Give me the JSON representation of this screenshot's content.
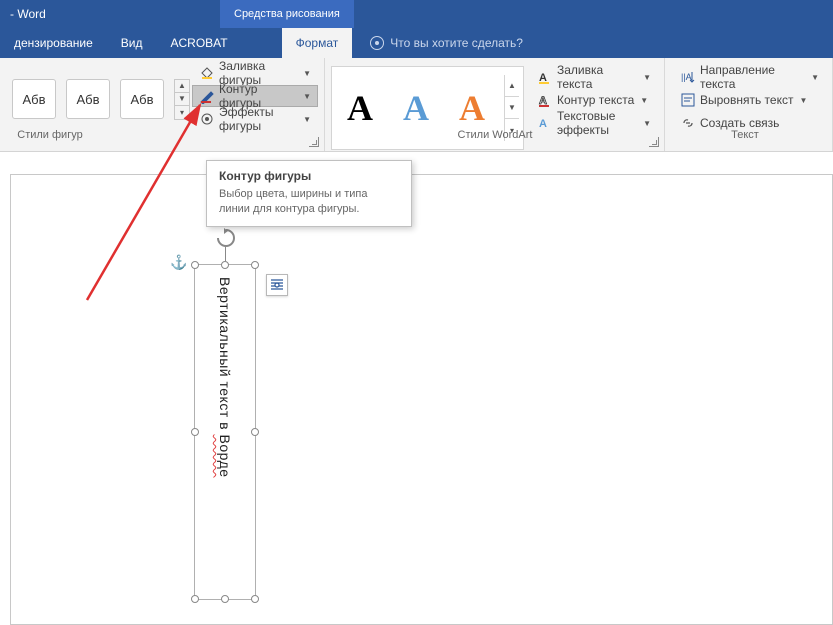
{
  "title_bar": {
    "app_name": "- Word",
    "context_tab": "Средства рисования"
  },
  "tabs": {
    "review": "дензирование",
    "view": "Вид",
    "acrobat": "ACROBAT",
    "format": "Формат",
    "tellme_placeholder": "Что вы хотите сделать?"
  },
  "ribbon": {
    "shape_styles": {
      "sample_text": "Абв",
      "fill": "Заливка фигуры",
      "outline": "Контур фигуры",
      "effects": "Эффекты фигуры",
      "label": "Стили фигур"
    },
    "wordart": {
      "text_fill": "Заливка текста",
      "text_outline": "Контур текста",
      "text_effects": "Текстовые эффекты",
      "label": "Стили WordArt"
    },
    "text": {
      "direction": "Направление текста",
      "align": "Выровнять текст",
      "link": "Создать связь",
      "label": "Текст"
    }
  },
  "tooltip": {
    "title": "Контур фигуры",
    "desc": "Выбор цвета, ширины и типа линии для контура фигуры."
  },
  "document": {
    "textbox_content_1": "Вертикальный текст в ",
    "textbox_content_2": "Ворде"
  }
}
